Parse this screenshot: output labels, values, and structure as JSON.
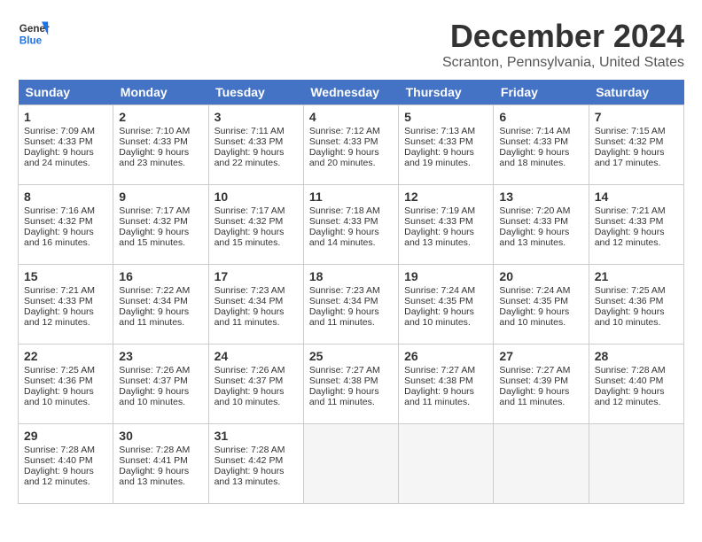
{
  "logo": {
    "line1": "General",
    "line2": "Blue"
  },
  "title": "December 2024",
  "location": "Scranton, Pennsylvania, United States",
  "days_header": [
    "Sunday",
    "Monday",
    "Tuesday",
    "Wednesday",
    "Thursday",
    "Friday",
    "Saturday"
  ],
  "weeks": [
    [
      {
        "day": "1",
        "sunrise": "Sunrise: 7:09 AM",
        "sunset": "Sunset: 4:33 PM",
        "daylight": "Daylight: 9 hours and 24 minutes."
      },
      {
        "day": "2",
        "sunrise": "Sunrise: 7:10 AM",
        "sunset": "Sunset: 4:33 PM",
        "daylight": "Daylight: 9 hours and 23 minutes."
      },
      {
        "day": "3",
        "sunrise": "Sunrise: 7:11 AM",
        "sunset": "Sunset: 4:33 PM",
        "daylight": "Daylight: 9 hours and 22 minutes."
      },
      {
        "day": "4",
        "sunrise": "Sunrise: 7:12 AM",
        "sunset": "Sunset: 4:33 PM",
        "daylight": "Daylight: 9 hours and 20 minutes."
      },
      {
        "day": "5",
        "sunrise": "Sunrise: 7:13 AM",
        "sunset": "Sunset: 4:33 PM",
        "daylight": "Daylight: 9 hours and 19 minutes."
      },
      {
        "day": "6",
        "sunrise": "Sunrise: 7:14 AM",
        "sunset": "Sunset: 4:33 PM",
        "daylight": "Daylight: 9 hours and 18 minutes."
      },
      {
        "day": "7",
        "sunrise": "Sunrise: 7:15 AM",
        "sunset": "Sunset: 4:32 PM",
        "daylight": "Daylight: 9 hours and 17 minutes."
      }
    ],
    [
      {
        "day": "8",
        "sunrise": "Sunrise: 7:16 AM",
        "sunset": "Sunset: 4:32 PM",
        "daylight": "Daylight: 9 hours and 16 minutes."
      },
      {
        "day": "9",
        "sunrise": "Sunrise: 7:17 AM",
        "sunset": "Sunset: 4:32 PM",
        "daylight": "Daylight: 9 hours and 15 minutes."
      },
      {
        "day": "10",
        "sunrise": "Sunrise: 7:17 AM",
        "sunset": "Sunset: 4:32 PM",
        "daylight": "Daylight: 9 hours and 15 minutes."
      },
      {
        "day": "11",
        "sunrise": "Sunrise: 7:18 AM",
        "sunset": "Sunset: 4:33 PM",
        "daylight": "Daylight: 9 hours and 14 minutes."
      },
      {
        "day": "12",
        "sunrise": "Sunrise: 7:19 AM",
        "sunset": "Sunset: 4:33 PM",
        "daylight": "Daylight: 9 hours and 13 minutes."
      },
      {
        "day": "13",
        "sunrise": "Sunrise: 7:20 AM",
        "sunset": "Sunset: 4:33 PM",
        "daylight": "Daylight: 9 hours and 13 minutes."
      },
      {
        "day": "14",
        "sunrise": "Sunrise: 7:21 AM",
        "sunset": "Sunset: 4:33 PM",
        "daylight": "Daylight: 9 hours and 12 minutes."
      }
    ],
    [
      {
        "day": "15",
        "sunrise": "Sunrise: 7:21 AM",
        "sunset": "Sunset: 4:33 PM",
        "daylight": "Daylight: 9 hours and 12 minutes."
      },
      {
        "day": "16",
        "sunrise": "Sunrise: 7:22 AM",
        "sunset": "Sunset: 4:34 PM",
        "daylight": "Daylight: 9 hours and 11 minutes."
      },
      {
        "day": "17",
        "sunrise": "Sunrise: 7:23 AM",
        "sunset": "Sunset: 4:34 PM",
        "daylight": "Daylight: 9 hours and 11 minutes."
      },
      {
        "day": "18",
        "sunrise": "Sunrise: 7:23 AM",
        "sunset": "Sunset: 4:34 PM",
        "daylight": "Daylight: 9 hours and 11 minutes."
      },
      {
        "day": "19",
        "sunrise": "Sunrise: 7:24 AM",
        "sunset": "Sunset: 4:35 PM",
        "daylight": "Daylight: 9 hours and 10 minutes."
      },
      {
        "day": "20",
        "sunrise": "Sunrise: 7:24 AM",
        "sunset": "Sunset: 4:35 PM",
        "daylight": "Daylight: 9 hours and 10 minutes."
      },
      {
        "day": "21",
        "sunrise": "Sunrise: 7:25 AM",
        "sunset": "Sunset: 4:36 PM",
        "daylight": "Daylight: 9 hours and 10 minutes."
      }
    ],
    [
      {
        "day": "22",
        "sunrise": "Sunrise: 7:25 AM",
        "sunset": "Sunset: 4:36 PM",
        "daylight": "Daylight: 9 hours and 10 minutes."
      },
      {
        "day": "23",
        "sunrise": "Sunrise: 7:26 AM",
        "sunset": "Sunset: 4:37 PM",
        "daylight": "Daylight: 9 hours and 10 minutes."
      },
      {
        "day": "24",
        "sunrise": "Sunrise: 7:26 AM",
        "sunset": "Sunset: 4:37 PM",
        "daylight": "Daylight: 9 hours and 10 minutes."
      },
      {
        "day": "25",
        "sunrise": "Sunrise: 7:27 AM",
        "sunset": "Sunset: 4:38 PM",
        "daylight": "Daylight: 9 hours and 11 minutes."
      },
      {
        "day": "26",
        "sunrise": "Sunrise: 7:27 AM",
        "sunset": "Sunset: 4:38 PM",
        "daylight": "Daylight: 9 hours and 11 minutes."
      },
      {
        "day": "27",
        "sunrise": "Sunrise: 7:27 AM",
        "sunset": "Sunset: 4:39 PM",
        "daylight": "Daylight: 9 hours and 11 minutes."
      },
      {
        "day": "28",
        "sunrise": "Sunrise: 7:28 AM",
        "sunset": "Sunset: 4:40 PM",
        "daylight": "Daylight: 9 hours and 12 minutes."
      }
    ],
    [
      {
        "day": "29",
        "sunrise": "Sunrise: 7:28 AM",
        "sunset": "Sunset: 4:40 PM",
        "daylight": "Daylight: 9 hours and 12 minutes."
      },
      {
        "day": "30",
        "sunrise": "Sunrise: 7:28 AM",
        "sunset": "Sunset: 4:41 PM",
        "daylight": "Daylight: 9 hours and 13 minutes."
      },
      {
        "day": "31",
        "sunrise": "Sunrise: 7:28 AM",
        "sunset": "Sunset: 4:42 PM",
        "daylight": "Daylight: 9 hours and 13 minutes."
      },
      null,
      null,
      null,
      null
    ]
  ]
}
